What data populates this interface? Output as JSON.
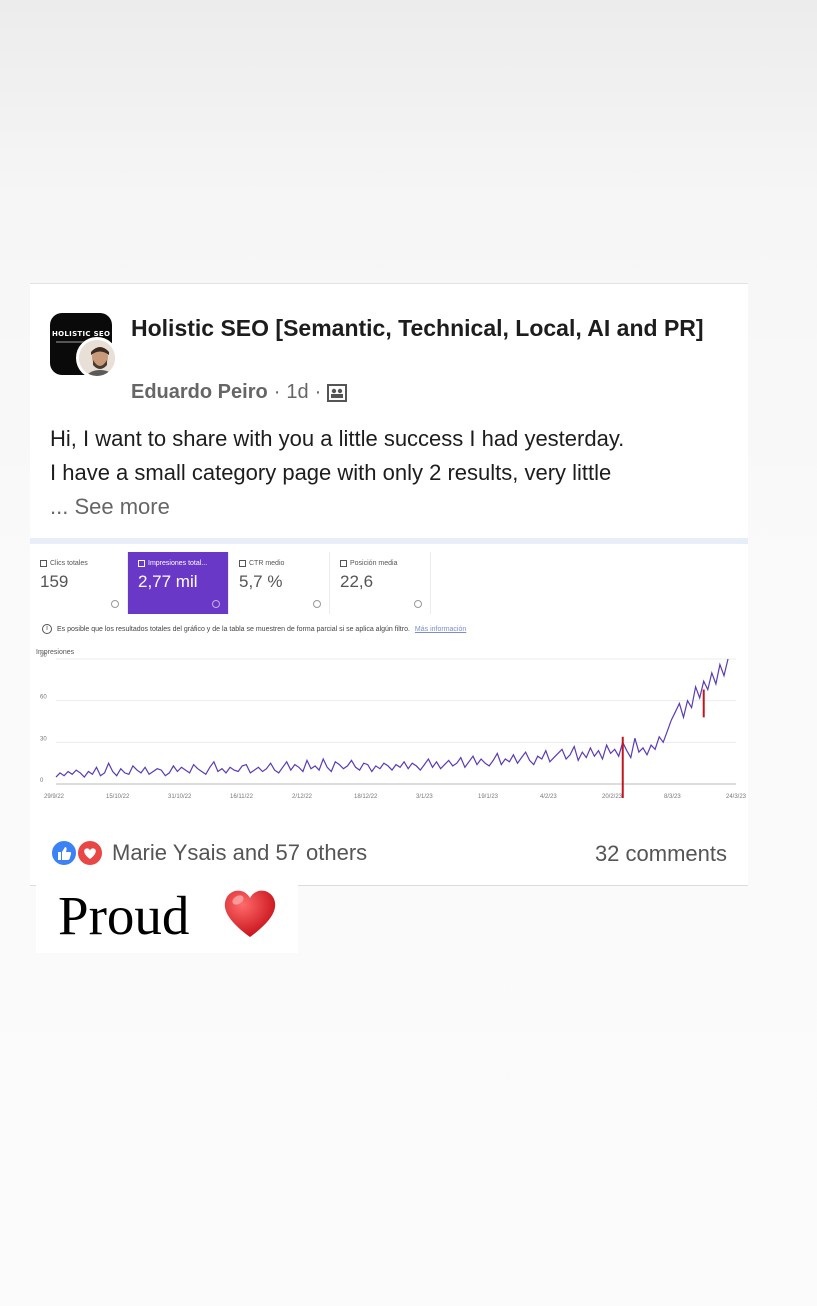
{
  "post": {
    "group_name": "Holistic SEO [Semantic, Technical, Local, AI and PR]",
    "logo_text": "HOLISTIC SEO",
    "author": "Eduardo Peiro",
    "time": "1d",
    "separator": "·",
    "body_line1": "Hi, I want to share with you a little success I had yesterday.",
    "body_line2": "I have a small category page with only 2 results, very little",
    "see_more": "... See more",
    "reactions_text": "Marie Ysais and 57 others",
    "comments_text": "32 comments"
  },
  "gsc": {
    "metrics": [
      {
        "label": "Clics totales",
        "value": "159",
        "active": false
      },
      {
        "label": "Impresiones total...",
        "value": "2,77 mil",
        "active": true
      },
      {
        "label": "CTR medio",
        "value": "5,7 %",
        "active": false
      },
      {
        "label": "Posición media",
        "value": "22,6",
        "active": false
      }
    ],
    "notice": "Es posible que los resultados totales del gráfico y de la tabla se muestren de forma parcial si se aplica algún filtro.",
    "notice_link": "Más información"
  },
  "chart_data": {
    "type": "line",
    "ylabel": "Impresiones",
    "ylim": [
      0,
      90
    ],
    "yticks": [
      "0",
      "30",
      "60",
      "90"
    ],
    "xticks": [
      "29/9/22",
      "15/10/22",
      "31/10/22",
      "16/11/22",
      "2/12/22",
      "18/12/22",
      "3/1/23",
      "19/1/23",
      "4/2/23",
      "20/2/23",
      "8/3/23",
      "24/3/23"
    ],
    "series": [
      {
        "values": [
          5,
          8,
          6,
          9,
          7,
          10,
          8,
          5,
          9,
          7,
          12,
          6,
          8,
          15,
          9,
          6,
          11,
          8,
          7,
          13,
          10,
          8,
          12,
          7,
          9,
          11,
          10,
          6,
          8,
          13,
          9,
          12,
          10,
          8,
          14,
          11,
          9,
          7,
          12,
          16,
          9,
          11,
          8,
          12,
          10,
          9,
          13,
          14,
          8,
          10,
          12,
          9,
          11,
          15,
          10,
          8,
          12,
          16,
          10,
          14,
          12,
          9,
          17,
          11,
          13,
          10,
          18,
          12,
          9,
          16,
          14,
          11,
          13,
          17,
          12,
          10,
          15,
          14,
          9,
          13,
          11,
          15,
          13,
          10,
          14,
          12,
          16,
          11,
          15,
          13,
          10,
          14,
          18,
          12,
          16,
          11,
          14,
          17,
          13,
          15,
          19,
          12,
          16,
          20,
          14,
          18,
          15,
          13,
          17,
          22,
          14,
          18,
          16,
          21,
          15,
          19,
          23,
          17,
          14,
          20,
          18,
          24,
          16,
          19,
          22,
          25,
          18,
          21,
          27,
          17,
          23,
          19,
          26,
          20,
          24,
          18,
          28,
          22,
          25,
          20,
          30,
          24,
          19,
          33,
          23,
          26,
          21,
          28,
          25,
          34,
          30,
          38,
          46,
          52,
          58,
          48,
          60,
          55,
          70,
          62,
          74,
          68,
          80,
          72,
          86,
          78,
          90
        ]
      }
    ],
    "red_markers_at": [
      140,
      160
    ],
    "grid": true
  },
  "proud": {
    "text": "Proud"
  }
}
